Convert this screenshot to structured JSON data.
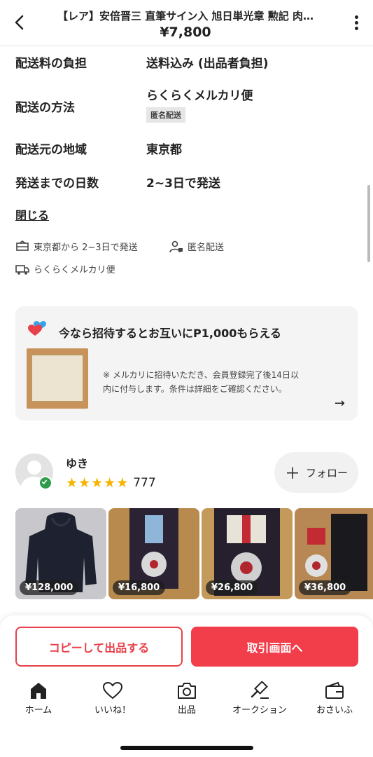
{
  "header": {
    "title": "【レア】安倍晋三 直筆サイン入 旭日単光章 勲記 肉…",
    "price": "¥7,800"
  },
  "shipping": {
    "rows": [
      {
        "label": "配送料の負担",
        "value": "送料込み (出品者負担)"
      },
      {
        "label": "配送の方法",
        "value": "らくらくメルカリ便"
      },
      {
        "label": "配送元の地域",
        "value": "東京都"
      },
      {
        "label": "発送までの日数",
        "value": "2~3日で発送"
      }
    ],
    "anon_badge": "匿名配送",
    "close_label": "閉じる",
    "summary": {
      "ship_from": "東京都から 2~3日で発送",
      "anon": "匿名配送",
      "method": "らくらくメルカリ便"
    }
  },
  "invite": {
    "title": "今なら招待するとお互いにP1,000もらえる",
    "note": "※ メルカリに招待いただき、会員登録完了後14日以内に付与します。条件は詳細をご確認ください。"
  },
  "seller": {
    "name": "ゆき",
    "rating_stars": 5,
    "review_count": "777",
    "follow_label": "フォロー"
  },
  "items": [
    {
      "price": "¥128,000",
      "icon": "hoodie"
    },
    {
      "price": "¥16,800",
      "icon": "medal"
    },
    {
      "price": "¥26,800",
      "icon": "medal"
    },
    {
      "price": "¥36,800",
      "icon": "medal"
    }
  ],
  "actions": {
    "copy_label": "コピーして出品する",
    "trade_label": "取引画面へ"
  },
  "tabs": [
    {
      "label": "ホーム",
      "icon": "home-icon"
    },
    {
      "label": "いいね！",
      "icon": "heart-icon"
    },
    {
      "label": "出品",
      "icon": "camera-icon"
    },
    {
      "label": "オークション",
      "icon": "gavel-icon"
    },
    {
      "label": "おさいふ",
      "icon": "wallet-icon"
    }
  ],
  "colors": {
    "accent": "#f23d4a",
    "star": "#f5b400",
    "verified": "#2e9d4b"
  }
}
